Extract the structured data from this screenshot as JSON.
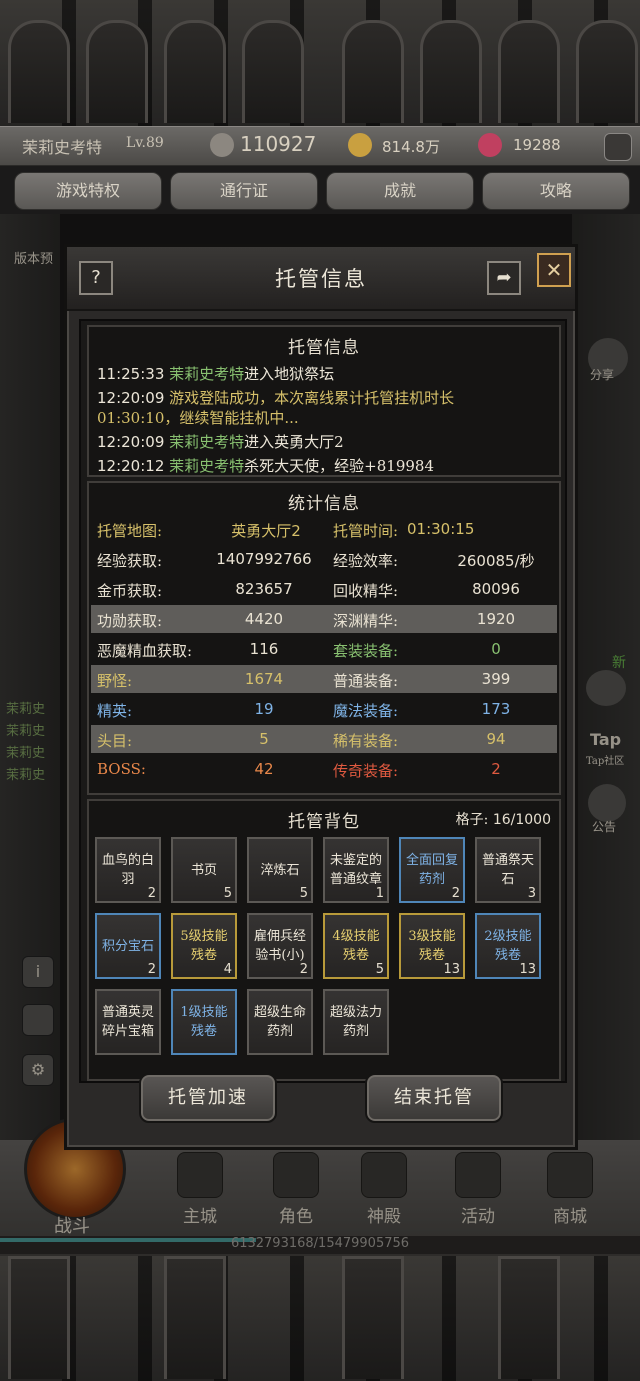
{
  "player": {
    "name": "茉莉史考特",
    "level": "Lv.89",
    "power": "110927",
    "gold": "814.8万",
    "gems": "19288"
  },
  "top_tabs": [
    "游戏特权",
    "通行证",
    "成就",
    "攻略"
  ],
  "side_left_label": "版本预",
  "side_left_chat": [
    "茉莉史",
    "茉莉史",
    "茉莉史",
    "茉莉史"
  ],
  "side_right": {
    "share": "分享",
    "new_badge": "新",
    "tap": "Tap",
    "tap_label": "Tap社区",
    "notice": "公告"
  },
  "modal": {
    "title": "托管信息",
    "help": "?",
    "close": "✕",
    "log_panel": {
      "title": "托管信息",
      "lines": [
        {
          "time": "11:25:33",
          "name": "茉莉史考特",
          "text": "进入地狱祭坛",
          "cont": ""
        },
        {
          "time": "12:20:09",
          "name": "",
          "text": "游戏登陆成功，本次离线累计托管挂机时长",
          "cont": "01:30:10，继续智能挂机中..."
        },
        {
          "time": "12:20:09",
          "name": "茉莉史考特",
          "text": "进入英勇大厅2",
          "cont": ""
        },
        {
          "time": "12:20:12",
          "name": "茉莉史考特",
          "text": "杀死大天使，经验+819984",
          "cont": ""
        }
      ]
    },
    "stats_panel": {
      "title": "统计信息",
      "rows": [
        {
          "l1": "托管地图:",
          "v1": "英勇大厅2",
          "l2": "托管时间:",
          "v2": "01:30:15"
        },
        {
          "l1": "经验获取:",
          "v1": "1407992766",
          "l2": "经验效率:",
          "v2": "260085/秒"
        },
        {
          "l1": "金币获取:",
          "v1": "823657",
          "l2": "回收精华:",
          "v2": "80096"
        },
        {
          "l1": "功勋获取:",
          "v1": "4420",
          "l2": "深渊精华:",
          "v2": "1920"
        },
        {
          "l1": "恶魔精血获取:",
          "v1": "116",
          "l2": "套装装备:",
          "v2": "0"
        },
        {
          "l1": "野怪:",
          "v1": "1674",
          "l2": "普通装备:",
          "v2": "399"
        },
        {
          "l1": "精英:",
          "v1": "19",
          "l2": "魔法装备:",
          "v2": "173"
        },
        {
          "l1": "头目:",
          "v1": "5",
          "l2": "稀有装备:",
          "v2": "94"
        },
        {
          "l1": "BOSS:",
          "v1": "42",
          "l2": "传奇装备:",
          "v2": "2"
        }
      ]
    },
    "bag_panel": {
      "title": "托管背包",
      "capacity_label": "格子:",
      "capacity": "16/1000",
      "items": [
        {
          "name": "血鸟的白羽",
          "count": "2",
          "rarity": "normal"
        },
        {
          "name": "书页",
          "count": "5",
          "rarity": "normal"
        },
        {
          "name": "淬炼石",
          "count": "5",
          "rarity": "normal"
        },
        {
          "name": "未鉴定的普通纹章",
          "count": "1",
          "rarity": "normal"
        },
        {
          "name": "全面回复药剂",
          "count": "2",
          "rarity": "blue"
        },
        {
          "name": "普通祭天石",
          "count": "3",
          "rarity": "normal"
        },
        {
          "name": "积分宝石",
          "count": "2",
          "rarity": "blue"
        },
        {
          "name": "5级技能残卷",
          "count": "4",
          "rarity": "gold"
        },
        {
          "name": "雇佣兵经验书(小)",
          "count": "2",
          "rarity": "normal"
        },
        {
          "name": "4级技能残卷",
          "count": "5",
          "rarity": "gold"
        },
        {
          "name": "3级技能残卷",
          "count": "13",
          "rarity": "gold"
        },
        {
          "name": "2级技能残卷",
          "count": "13",
          "rarity": "blue"
        },
        {
          "name": "普通英灵碎片宝箱",
          "count": "",
          "rarity": "normal"
        },
        {
          "name": "1级技能残卷",
          "count": "",
          "rarity": "blue"
        },
        {
          "name": "超级生命药剂",
          "count": "",
          "rarity": "normal"
        },
        {
          "name": "超级法力药剂",
          "count": "",
          "rarity": "normal"
        }
      ]
    },
    "buttons": {
      "speedup": "托管加速",
      "end": "结束托管"
    }
  },
  "bottom_nav": {
    "fight": "战斗",
    "items": [
      "主城",
      "角色",
      "神殿",
      "活动",
      "商城"
    ]
  },
  "exp_text": "6132793168/15479905756",
  "colors": {
    "green": "#88c070",
    "yellow": "#d6c06a",
    "blue": "#7fb3e6",
    "gold": "#e6cf70",
    "orange": "#e8874a",
    "red": "#e05a40"
  }
}
